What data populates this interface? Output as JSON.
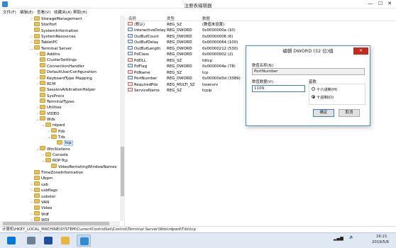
{
  "window": {
    "title": "注册表编辑器",
    "min": "—",
    "max": "☐",
    "close": "✕"
  },
  "menu": [
    "文件(F)",
    "编辑(E)",
    "查看(V)",
    "收藏夹(A)",
    "帮助(H)"
  ],
  "tree": [
    {
      "label": "StorageManagement",
      "exp": "›",
      "indent": 0
    },
    {
      "label": "StorPort",
      "exp": "",
      "indent": 0
    },
    {
      "label": "SystemInformation",
      "exp": "",
      "indent": 0
    },
    {
      "label": "SystemResources",
      "exp": "›",
      "indent": 0
    },
    {
      "label": "TabletPC",
      "exp": "›",
      "indent": 0
    },
    {
      "label": "Terminal Server",
      "exp": "⌄",
      "indent": 0
    },
    {
      "label": "AddIns",
      "exp": "›",
      "indent": 1
    },
    {
      "label": "ClusterSettings",
      "exp": "",
      "indent": 1
    },
    {
      "label": "ConnectionHandler",
      "exp": "",
      "indent": 1
    },
    {
      "label": "DefaultUserConfiguration",
      "exp": "",
      "indent": 1
    },
    {
      "label": "KeyboardType Mapping",
      "exp": "›",
      "indent": 1
    },
    {
      "label": "RCM",
      "exp": "›",
      "indent": 1
    },
    {
      "label": "SessionArbitrationHelper",
      "exp": "",
      "indent": 1
    },
    {
      "label": "SysProcs",
      "exp": "",
      "indent": 1
    },
    {
      "label": "TerminalTypes",
      "exp": "",
      "indent": 1
    },
    {
      "label": "Utilities",
      "exp": "›",
      "indent": 1
    },
    {
      "label": "VIDEO",
      "exp": "›",
      "indent": 1
    },
    {
      "label": "Wds",
      "exp": "⌄",
      "indent": 1
    },
    {
      "label": "rdpwd",
      "exp": "⌄",
      "indent": 2
    },
    {
      "label": "Pds",
      "exp": "›",
      "indent": 3
    },
    {
      "label": "Tds",
      "exp": "⌄",
      "indent": 3
    },
    {
      "label": "tcp",
      "exp": "",
      "indent": 4,
      "selected": true
    },
    {
      "label": "WinStations",
      "exp": "⌄",
      "indent": 1
    },
    {
      "label": "Console",
      "exp": "›",
      "indent": 2
    },
    {
      "label": "RDP-Tcp",
      "exp": "⌄",
      "indent": 2
    },
    {
      "label": "VideoRemotingWindowNames",
      "exp": "",
      "indent": 3
    },
    {
      "label": "TimeZoneInformation",
      "exp": "",
      "indent": 0
    },
    {
      "label": "Ubpm",
      "exp": "",
      "indent": 0
    },
    {
      "label": "usb",
      "exp": "›",
      "indent": 0
    },
    {
      "label": "usbflags",
      "exp": "›",
      "indent": 0
    },
    {
      "label": "usbstor",
      "exp": "",
      "indent": 0
    },
    {
      "label": "VAN",
      "exp": "›",
      "indent": 0
    },
    {
      "label": "Video",
      "exp": "",
      "indent": 0
    },
    {
      "label": "Wdf",
      "exp": "›",
      "indent": 0
    },
    {
      "label": "WDI",
      "exp": "›",
      "indent": 0
    }
  ],
  "list": {
    "headers": {
      "name": "名称",
      "type": "类型",
      "data": "数据"
    },
    "rows": [
      {
        "icon": "sz",
        "name": "(默认)",
        "type": "REG_SZ",
        "data": "(数值未设置)"
      },
      {
        "icon": "dw",
        "name": "InteractiveDelay",
        "type": "REG_DWORD",
        "data": "0x0000000a (10)"
      },
      {
        "icon": "dw",
        "name": "OutBufCount",
        "type": "REG_DWORD",
        "data": "0x00000006 (6)"
      },
      {
        "icon": "dw",
        "name": "OutBufDelay",
        "type": "REG_DWORD",
        "data": "0x00000064 (100)"
      },
      {
        "icon": "dw",
        "name": "OutBufLength",
        "type": "REG_DWORD",
        "data": "0x00000212 (530)"
      },
      {
        "icon": "dw",
        "name": "PdClass",
        "type": "REG_DWORD",
        "data": "0x00000002 (2)"
      },
      {
        "icon": "sz",
        "name": "PdDLL",
        "type": "REG_SZ",
        "data": "tdtcp"
      },
      {
        "icon": "dw",
        "name": "PdFlag",
        "type": "REG_DWORD",
        "data": "0x0000004e (78)"
      },
      {
        "icon": "sz",
        "name": "PdName",
        "type": "REG_SZ",
        "data": "tcp"
      },
      {
        "icon": "dw",
        "name": "PortNumber",
        "type": "REG_DWORD",
        "data": "0x00000d3d (3389)"
      },
      {
        "icon": "sz",
        "name": "RequiredPds",
        "type": "REG_MULTI_SZ",
        "data": "tssecsrv"
      },
      {
        "icon": "sz",
        "name": "ServiceName",
        "type": "REG_SZ",
        "data": "tcpip"
      }
    ]
  },
  "status": "计算机\\HKEY_LOCAL_MACHINE\\SYSTEM\\CurrentControlSet\\Control\\Terminal Server\\Wds\\rdpwd\\Tds\\tcp",
  "dialog": {
    "title": "编辑 DWORD (32 位)值",
    "close": "✕",
    "name_label": "数值名称(N):",
    "name_value": "PortNumber",
    "data_label": "数值数据(V):",
    "data_value": "1109",
    "base_label": "基数",
    "hex_label": "十六进制(H)",
    "dec_label": "十进制(D)",
    "base_selected": "dec",
    "ok": "确定",
    "cancel": "取消"
  },
  "taskbar": {
    "items": [
      {
        "icon": "start-icon",
        "color": "#0078d7"
      },
      {
        "icon": "server-manager-icon",
        "color": "#6b7f96"
      },
      {
        "icon": "powershell-icon",
        "color": "#1f4e9c"
      },
      {
        "icon": "file-explorer-icon",
        "color": "#e8b63d"
      },
      {
        "icon": "regedit-icon",
        "color": "#2e8bd6"
      }
    ],
    "time": "16:21",
    "date": "2019/5/6"
  }
}
